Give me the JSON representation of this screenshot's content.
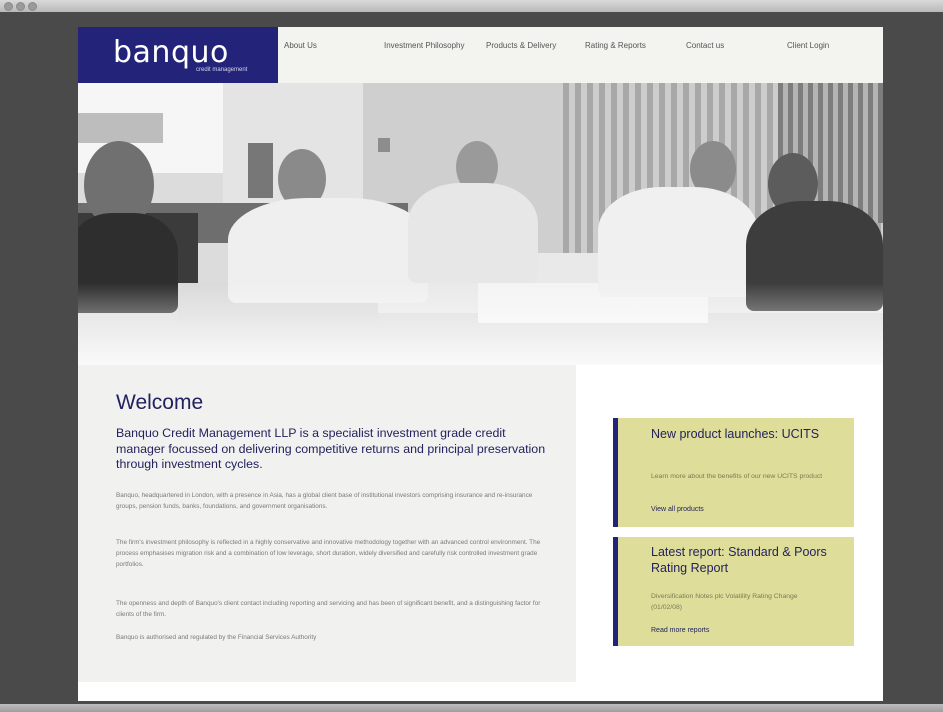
{
  "brand": {
    "name": "banquo",
    "tagline": "credit management"
  },
  "nav": [
    {
      "label": "About Us"
    },
    {
      "label": "Investment Philosophy"
    },
    {
      "label": "Products & Delivery"
    },
    {
      "label": "Rating & Reports"
    },
    {
      "label": "Contact us"
    },
    {
      "label": "Client Login"
    }
  ],
  "welcome": {
    "title": "Welcome",
    "lead": "Banquo Credit Management LLP is a specialist investment grade credit manager focussed on delivering competitive returns and principal preservation through investment cycles.",
    "paragraphs": [
      "Banquo, headquartered in London, with a presence in Asia, has a global client base of institutional investors comprising insurance and re-insurance groups, pension funds, banks, foundations, and government organisations.",
      "The firm's investment philosophy is reflected in a highly conservative and innovative methodology together with an advanced control environment. The process emphasises migration risk and a combination of low leverage, short duration, widely diversified and carefully risk controlled investment grade portfolios.",
      "The openness and depth of Banquo's client contact including reporting and servicing and has been of significant benefit, and a distinguishing factor for clients of the firm.",
      "Banquo is authorised and regulated by the Financial Services Authority"
    ]
  },
  "promos": [
    {
      "title": "New product launches: UCITS",
      "text": "Learn more about the benefits of our new UCITS product",
      "link": "View all products"
    },
    {
      "title": "Latest report: Standard & Poors Rating Report",
      "text": "Diversification Notes plc Volatility Rating Change (01/02/08)",
      "link": "Read more reports"
    }
  ],
  "colors": {
    "brand_navy": "#24237a",
    "promo_bg": "#dedd9a",
    "welcome_bg": "#f1f1ef"
  }
}
